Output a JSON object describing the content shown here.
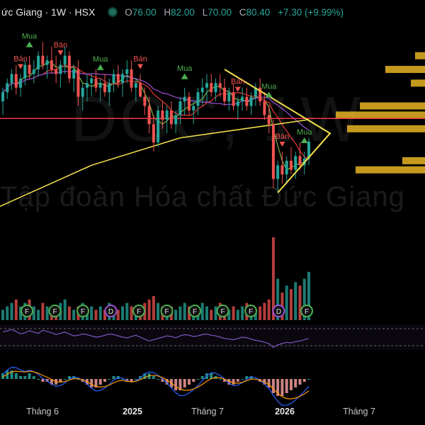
{
  "header": {
    "symbol": "ức Giang · 1W · HSX",
    "open_label": "O",
    "open": "76.00",
    "high_label": "H",
    "high": "82.00",
    "low_label": "L",
    "low": "70.00",
    "close_label": "C",
    "close": "80.40",
    "change": "+7.30 (+9.99%)"
  },
  "watermark": {
    "ticker": "DGC, 1W",
    "company": "Tập đoàn Hóa chất Đức Giang"
  },
  "colors": {
    "up": "#26a69a",
    "down": "#ef5350",
    "ma_yellow": "#f4e04d",
    "ma_purple": "#9c4fd6",
    "ma_red": "#e53935",
    "ma_green": "#7cb342",
    "volume_profile": "#e6b422",
    "hline": "#f23645"
  },
  "chart_data": {
    "type": "candlestick",
    "timeframe": "1W",
    "x_labels": [
      "Tháng 6",
      "2025",
      "Tháng 7",
      "2026",
      "Tháng 7"
    ],
    "x_label_bold": [
      false,
      true,
      false,
      true,
      false
    ],
    "candles": [
      [
        98,
        104,
        92,
        102
      ],
      [
        102,
        108,
        99,
        106
      ],
      [
        106,
        112,
        103,
        110
      ],
      [
        110,
        114,
        101,
        104
      ],
      [
        104,
        110,
        100,
        108
      ],
      [
        108,
        116,
        105,
        114
      ],
      [
        114,
        118,
        108,
        110
      ],
      [
        110,
        116,
        106,
        112
      ],
      [
        112,
        120,
        109,
        118
      ],
      [
        118,
        124,
        112,
        114
      ],
      [
        114,
        118,
        108,
        116
      ],
      [
        116,
        122,
        110,
        112
      ],
      [
        112,
        118,
        106,
        110
      ],
      [
        110,
        116,
        104,
        114
      ],
      [
        114,
        122,
        110,
        118
      ],
      [
        118,
        120,
        106,
        108
      ],
      [
        108,
        114,
        102,
        112
      ],
      [
        112,
        116,
        96,
        100
      ],
      [
        100,
        106,
        94,
        104
      ],
      [
        104,
        110,
        98,
        106
      ],
      [
        106,
        110,
        100,
        108
      ],
      [
        108,
        112,
        102,
        104
      ],
      [
        104,
        108,
        98,
        106
      ],
      [
        106,
        110,
        100,
        102
      ],
      [
        102,
        108,
        96,
        106
      ],
      [
        106,
        112,
        102,
        110
      ],
      [
        110,
        114,
        104,
        106
      ],
      [
        106,
        112,
        100,
        110
      ],
      [
        110,
        116,
        106,
        112
      ],
      [
        112,
        116,
        102,
        104
      ],
      [
        104,
        108,
        98,
        106
      ],
      [
        106,
        110,
        102,
        100
      ],
      [
        100,
        104,
        92,
        96
      ],
      [
        96,
        100,
        84,
        88
      ],
      [
        88,
        92,
        76,
        80
      ],
      [
        80,
        96,
        78,
        94
      ],
      [
        94,
        98,
        86,
        90
      ],
      [
        90,
        96,
        84,
        94
      ],
      [
        94,
        98,
        86,
        88
      ],
      [
        88,
        94,
        84,
        92
      ],
      [
        92,
        100,
        88,
        98
      ],
      [
        98,
        104,
        92,
        100
      ],
      [
        100,
        102,
        92,
        94
      ],
      [
        94,
        98,
        88,
        96
      ],
      [
        96,
        104,
        92,
        102
      ],
      [
        102,
        108,
        96,
        104
      ],
      [
        104,
        110,
        98,
        106
      ],
      [
        106,
        110,
        100,
        102
      ],
      [
        102,
        108,
        98,
        106
      ],
      [
        106,
        110,
        100,
        104
      ],
      [
        104,
        108,
        96,
        98
      ],
      [
        98,
        104,
        94,
        102
      ],
      [
        102,
        106,
        94,
        96
      ],
      [
        96,
        100,
        90,
        98
      ],
      [
        98,
        104,
        94,
        100
      ],
      [
        100,
        104,
        94,
        96
      ],
      [
        96,
        102,
        92,
        100
      ],
      [
        100,
        106,
        96,
        104
      ],
      [
        104,
        108,
        96,
        98
      ],
      [
        98,
        102,
        90,
        92
      ],
      [
        92,
        96,
        84,
        88
      ],
      [
        88,
        90,
        60,
        64
      ],
      [
        64,
        72,
        58,
        70
      ],
      [
        70,
        76,
        62,
        66
      ],
      [
        66,
        74,
        62,
        72
      ],
      [
        72,
        78,
        66,
        68
      ],
      [
        68,
        76,
        64,
        74
      ],
      [
        74,
        80,
        68,
        70
      ],
      [
        70,
        76,
        66,
        73
      ],
      [
        73,
        82,
        70,
        80.4
      ]
    ],
    "price_ylim": [
      40,
      130
    ],
    "signals": [
      {
        "label": "Mua",
        "index": 6,
        "type": "buy"
      },
      {
        "label": "Bán",
        "index": 4,
        "type": "sell"
      },
      {
        "label": "Bán",
        "index": 13,
        "type": "sell"
      },
      {
        "label": "Mua",
        "index": 22,
        "type": "buy"
      },
      {
        "label": "Bán",
        "index": 31,
        "type": "sell"
      },
      {
        "label": "Mua",
        "index": 41,
        "type": "buy"
      },
      {
        "label": "Bán",
        "index": 53,
        "type": "sell"
      },
      {
        "label": "Mua",
        "index": 60,
        "type": "buy"
      },
      {
        "label": "Bán",
        "index": 63,
        "type": "sell"
      },
      {
        "label": "Mua",
        "index": 68,
        "type": "buy"
      }
    ],
    "volume_profile": [
      {
        "price": 118,
        "width": 14
      },
      {
        "price": 112,
        "width": 56
      },
      {
        "price": 106,
        "width": 20
      },
      {
        "price": 96,
        "width": 92
      },
      {
        "price": 92,
        "width": 126
      },
      {
        "price": 86,
        "width": 110
      },
      {
        "price": 72,
        "width": 32
      },
      {
        "price": 68,
        "width": 98
      }
    ],
    "horizontal_line_price": 90.5,
    "volume": [
      3,
      4,
      5,
      6,
      4,
      5,
      6,
      4,
      3,
      5,
      4,
      3,
      4,
      5,
      6,
      4,
      3,
      4,
      5,
      3,
      4,
      3,
      4,
      3,
      5,
      4,
      3,
      4,
      5,
      4,
      3,
      4,
      5,
      6,
      7,
      5,
      4,
      3,
      4,
      3,
      4,
      5,
      4,
      3,
      4,
      5,
      4,
      3,
      4,
      5,
      4,
      3,
      4,
      3,
      4,
      5,
      4,
      3,
      4,
      5,
      6,
      24,
      12,
      8,
      10,
      9,
      11,
      10,
      12,
      14
    ],
    "volume_markers": [
      "F",
      "F",
      "F",
      "D",
      "F",
      "F",
      "F",
      "F",
      "F",
      "D",
      "F"
    ],
    "rsi": [
      58,
      60,
      62,
      59,
      55,
      57,
      60,
      58,
      56,
      61,
      59,
      57,
      54,
      56,
      58,
      55,
      52,
      53,
      55,
      54,
      52,
      50,
      51,
      53,
      55,
      54,
      52,
      50,
      49,
      51,
      53,
      50,
      47,
      44,
      46,
      48,
      50,
      52,
      51,
      49,
      52,
      54,
      53,
      51,
      52,
      54,
      55,
      53,
      52,
      50,
      48,
      47,
      46,
      48,
      50,
      49,
      47,
      45,
      44,
      42,
      40,
      34,
      38,
      40,
      42,
      41,
      43,
      44,
      46,
      48
    ],
    "macd_hist": [
      2,
      3,
      3,
      2,
      1,
      1,
      2,
      1,
      0,
      -1,
      -1,
      -2,
      -2,
      -1,
      0,
      1,
      1,
      0,
      -1,
      -2,
      -3,
      -3,
      -2,
      -1,
      0,
      1,
      1,
      0,
      -1,
      -1,
      0,
      1,
      2,
      2,
      1,
      0,
      -1,
      -2,
      -3,
      -4,
      -4,
      -3,
      -2,
      -1,
      0,
      1,
      2,
      2,
      1,
      0,
      -1,
      -2,
      -2,
      -1,
      0,
      1,
      1,
      0,
      -1,
      -2,
      -3,
      -5,
      -6,
      -6,
      -5,
      -4,
      -3,
      -2,
      -1,
      0
    ]
  }
}
